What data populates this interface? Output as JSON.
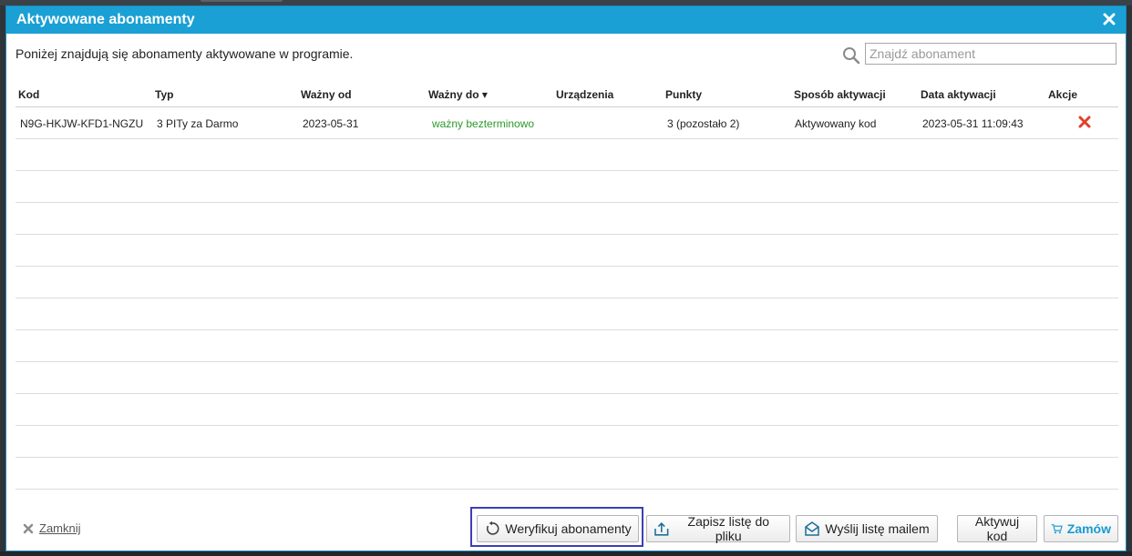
{
  "dialog": {
    "title": "Aktywowane abonamenty",
    "intro": "Poniżej znajdują się abonamenty aktywowane w programie."
  },
  "search": {
    "placeholder": "Znajdź abonament",
    "value": ""
  },
  "table": {
    "columns": [
      "Kod",
      "Typ",
      "Ważny od",
      "Ważny do ▾",
      "Urządzenia",
      "Punkty",
      "Sposób aktywacji",
      "Data aktywacji",
      "Akcje"
    ],
    "rows": [
      {
        "kod": "N9G-HKJW-KFD1-NGZU",
        "typ": "3 PITy za Darmo",
        "od": "2023-05-31",
        "do": "ważny bezterminowo",
        "urzadzenia": "",
        "punkty": "3 (pozostało 2)",
        "sposob": "Aktywowany kod",
        "data": "2023-05-31 11:09:43"
      }
    ]
  },
  "footer": {
    "close": "Zamknij",
    "verify": "Weryfikuj abonamenty",
    "save": "Zapisz listę do pliku",
    "mail": "Wyślij listę mailem",
    "activate": "Aktywuj kod",
    "order": "Zamów"
  },
  "colors": {
    "accent": "#1aa0d4",
    "valid": "#2a9a2a",
    "delete": "#e0412a",
    "focus": "#3d3fb5"
  }
}
